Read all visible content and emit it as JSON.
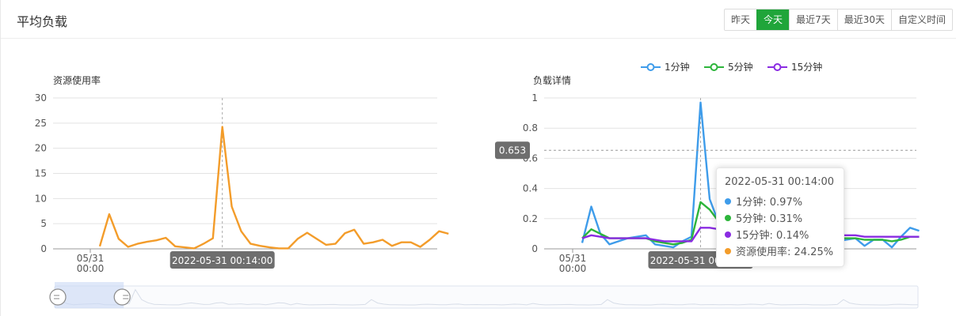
{
  "header": {
    "title": "平均负载",
    "ranges": [
      "昨天",
      "今天",
      "最近7天",
      "最近30天",
      "自定义时间"
    ],
    "active_range": "今天"
  },
  "chart_data": [
    {
      "type": "line",
      "title": "",
      "ylabel": "资源使用率",
      "xlabel": "",
      "ylim": [
        0,
        30
      ],
      "yticks": [
        0,
        5,
        10,
        15,
        20,
        25,
        30
      ],
      "x_tick_labels": [
        {
          "index": 0,
          "label": "05/31\n00:00"
        }
      ],
      "x_pointer_label": "2022-05-31 00:14:00",
      "pointer_index": 14,
      "series": [
        {
          "color": "#f39c2a",
          "values": [
            0.5,
            6.9,
            2.0,
            0.4,
            1.0,
            1.4,
            1.7,
            2.2,
            0.5,
            0.3,
            0.1,
            1.0,
            2.1,
            24.25,
            8.4,
            3.5,
            1.0,
            0.6,
            0.3,
            0.1,
            0.1,
            2.0,
            3.2,
            2.0,
            0.8,
            1.0,
            3.1,
            3.8,
            1.0,
            1.3,
            1.8,
            0.6,
            1.3,
            1.3,
            0.4,
            1.8,
            3.5,
            3.0
          ]
        }
      ]
    },
    {
      "type": "line",
      "title": "",
      "ylabel": "负载详情",
      "xlabel": "",
      "ylim": [
        0,
        1
      ],
      "yticks": [
        0,
        0.2,
        0.4,
        0.6,
        0.8,
        1
      ],
      "x_tick_labels": [
        {
          "index": 0,
          "label": "05/31\n00:00"
        }
      ],
      "x_pointer_label": "2022-05-31 00:14:00",
      "y_pointer_label": "0.653",
      "y_pointer_value": 0.653,
      "pointer_index": 14,
      "legend": {
        "position": "top-center"
      },
      "series": [
        {
          "name": "1分钟",
          "color": "#3e9cea",
          "values": [
            0.04,
            0.28,
            0.1,
            0.03,
            0.05,
            0.07,
            0.08,
            0.09,
            0.03,
            0.02,
            0.01,
            0.05,
            0.08,
            0.97,
            0.33,
            0.17,
            0.1,
            0.07,
            0.06,
            0.05,
            0.05,
            0.07,
            0.08,
            0.07,
            0.05,
            0.06,
            0.08,
            0.09,
            0.05,
            0.06,
            0.07,
            0.02,
            0.06,
            0.06,
            0.01,
            0.08,
            0.14,
            0.12
          ]
        },
        {
          "name": "5分钟",
          "color": "#2db53b",
          "values": [
            0.07,
            0.13,
            0.1,
            0.07,
            0.07,
            0.07,
            0.07,
            0.07,
            0.05,
            0.04,
            0.03,
            0.04,
            0.06,
            0.31,
            0.26,
            0.18,
            0.13,
            0.1,
            0.09,
            0.08,
            0.07,
            0.07,
            0.08,
            0.08,
            0.07,
            0.07,
            0.07,
            0.08,
            0.07,
            0.07,
            0.07,
            0.06,
            0.06,
            0.06,
            0.05,
            0.06,
            0.08,
            0.08
          ]
        },
        {
          "name": "15分钟",
          "color": "#8a2be2",
          "values": [
            0.07,
            0.09,
            0.08,
            0.07,
            0.07,
            0.07,
            0.07,
            0.07,
            0.06,
            0.05,
            0.05,
            0.05,
            0.05,
            0.14,
            0.14,
            0.13,
            0.12,
            0.11,
            0.1,
            0.1,
            0.09,
            0.09,
            0.09,
            0.09,
            0.09,
            0.09,
            0.09,
            0.09,
            0.09,
            0.09,
            0.09,
            0.08,
            0.08,
            0.08,
            0.08,
            0.08,
            0.08,
            0.08
          ]
        }
      ]
    }
  ],
  "tooltip": {
    "title": "2022-05-31 00:14:00",
    "rows": [
      {
        "label": "1分钟: 0.97%",
        "color": "#3e9cea"
      },
      {
        "label": "5分钟: 0.31%",
        "color": "#2db53b"
      },
      {
        "label": "15分钟: 0.14%",
        "color": "#8a2be2"
      },
      {
        "label": "资源使用率: 24.25%",
        "color": "#f39c2a"
      }
    ]
  },
  "datazoom": {
    "start": 0,
    "end": 0.08,
    "colors": {
      "fill": "#c9d8f5",
      "border": "#dde3ee",
      "handle": "#8a8a8a"
    }
  }
}
